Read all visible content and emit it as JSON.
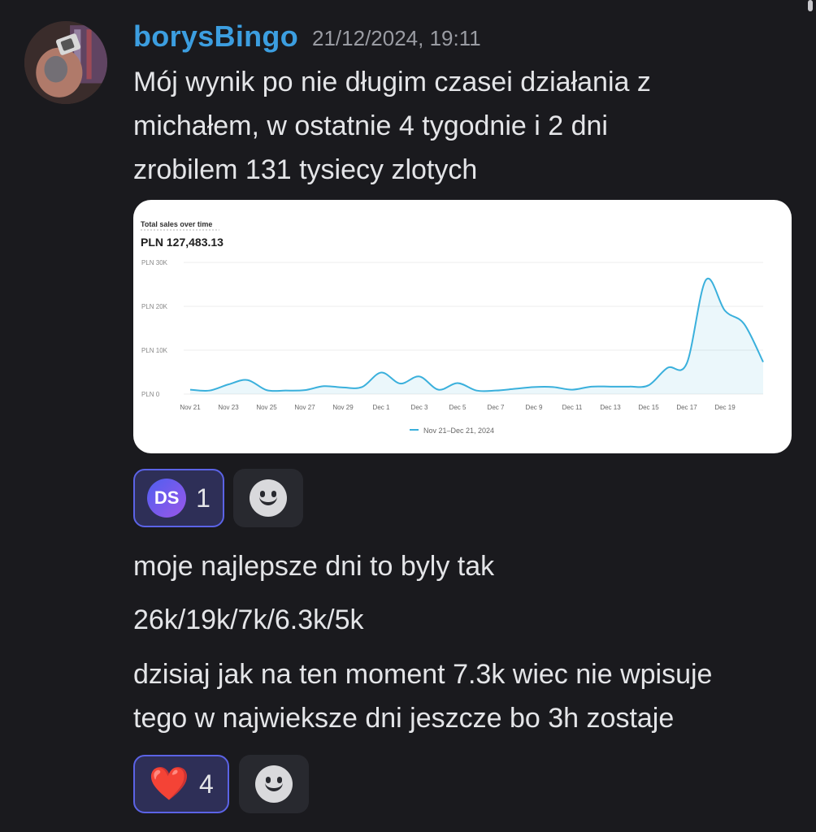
{
  "message": {
    "username": "borysBingo",
    "timestamp": "21/12/2024, 19:11",
    "lines": [
      "Mój wynik po nie długim czasei działania z",
      "michałem, w ostatnie 4 tygodnie i 2 dni",
      "zrobilem 131 tysiecy zlotych"
    ]
  },
  "followups": [
    "moje najlepsze dni to byly tak",
    "26k/19k/7k/6.3k/5k",
    "dzisiaj jak na ten moment 7.3k wiec nie wpisuje",
    "tego w najwieksze dni jeszcze bo 3h zostaje"
  ],
  "reactions": {
    "first": {
      "badge": "DS",
      "count": "1"
    },
    "second": {
      "emoji": "❤️",
      "count": "4"
    }
  },
  "chart_data": {
    "type": "area",
    "title": "Total sales over time",
    "total": "PLN 127,483.13",
    "y_ticks": [
      "PLN 0",
      "PLN 10K",
      "PLN 20K",
      "PLN 30K"
    ],
    "ylim": [
      0,
      30000
    ],
    "x_ticks": [
      "Nov 21",
      "Nov 23",
      "Nov 25",
      "Nov 27",
      "Nov 29",
      "Dec 1",
      "Dec 3",
      "Dec 5",
      "Dec 7",
      "Dec 9",
      "Dec 11",
      "Dec 13",
      "Dec 15",
      "Dec 17",
      "Dec 19"
    ],
    "legend": "Nov 21–Dec 21, 2024",
    "series_color": "#3ab0dc",
    "x": [
      "Nov 21",
      "Nov 22",
      "Nov 23",
      "Nov 24",
      "Nov 25",
      "Nov 26",
      "Nov 27",
      "Nov 28",
      "Nov 29",
      "Nov 30",
      "Dec 1",
      "Dec 2",
      "Dec 3",
      "Dec 4",
      "Dec 5",
      "Dec 6",
      "Dec 7",
      "Dec 8",
      "Dec 9",
      "Dec 10",
      "Dec 11",
      "Dec 12",
      "Dec 13",
      "Dec 14",
      "Dec 15",
      "Dec 16",
      "Dec 17",
      "Dec 18",
      "Dec 19",
      "Dec 20",
      "Dec 21"
    ],
    "values": [
      1000,
      800,
      2200,
      3200,
      900,
      800,
      900,
      1800,
      1500,
      1600,
      4900,
      2400,
      4000,
      1000,
      2500,
      800,
      800,
      1200,
      1600,
      1600,
      1000,
      1700,
      1700,
      1700,
      2000,
      6000,
      7000,
      26000,
      19000,
      16000,
      7300
    ]
  },
  "colors": {
    "username": "#3c9ee0",
    "reaction_border": "#5b63e6",
    "background": "#1a1a1e"
  }
}
